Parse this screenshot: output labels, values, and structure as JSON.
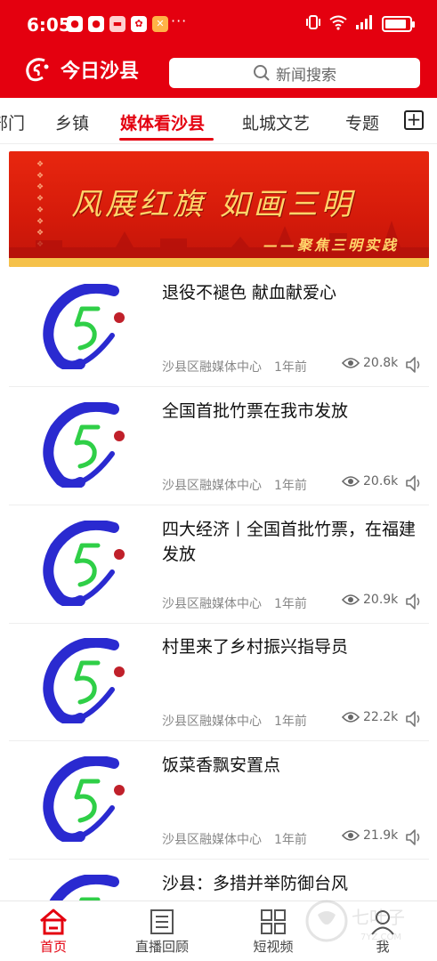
{
  "status_bar": {
    "time": "6:05",
    "app_icons": [
      "app-1",
      "app-2",
      "app-3",
      "app-4",
      "app-5"
    ],
    "more": "···",
    "signal_icons": [
      "vibrate-icon",
      "wifi-icon",
      "cell-signal-icon"
    ],
    "battery_level": 0.9
  },
  "header": {
    "app_name": "今日沙县",
    "search_placeholder": "新闻搜索",
    "brand_color": "#e4000f"
  },
  "tabs": {
    "items": [
      {
        "label": "部门"
      },
      {
        "label": "乡镇"
      },
      {
        "label": "媒体看沙县",
        "active": true
      },
      {
        "label": "虬城文艺"
      },
      {
        "label": "专题"
      }
    ],
    "add_icon": "plus-square-icon"
  },
  "banner": {
    "headline": "风展红旗 如画三明",
    "subline": "——聚焦三明实践"
  },
  "news": [
    {
      "title": "退役不褪色  献血献爱心",
      "source": "沙县区融媒体中心",
      "time": "1年前",
      "views": "20.8k"
    },
    {
      "title": "全国首批竹票在我市发放",
      "source": "沙县区融媒体中心",
      "time": "1年前",
      "views": "20.6k"
    },
    {
      "title": "四大经济丨全国首批竹票，在福建发放",
      "source": "沙县区融媒体中心",
      "time": "1年前",
      "views": "20.9k"
    },
    {
      "title": "村里来了乡村振兴指导员",
      "source": "沙县区融媒体中心",
      "time": "1年前",
      "views": "22.2k"
    },
    {
      "title": "饭菜香飘安置点",
      "source": "沙县区融媒体中心",
      "time": "1年前",
      "views": "21.9k"
    },
    {
      "title": "沙县：多措并举防御台风",
      "source": "",
      "time": "",
      "views": ""
    }
  ],
  "bottom_nav": [
    {
      "label": "首页",
      "icon": "home-icon",
      "active": true
    },
    {
      "label": "直播回顾",
      "icon": "document-icon"
    },
    {
      "label": "短视频",
      "icon": "grid-icon"
    },
    {
      "label": "我",
      "icon": "user-icon"
    }
  ]
}
